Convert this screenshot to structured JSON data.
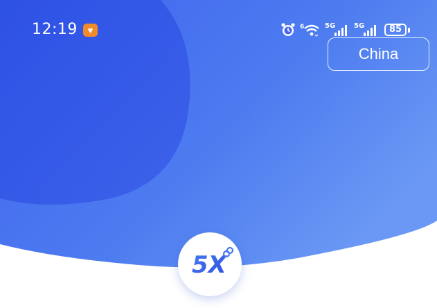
{
  "status_bar": {
    "time": "12:19",
    "notification_icon": "heart-icon",
    "network_1": "5G",
    "network_2": "5G",
    "wifi_badge": "6",
    "battery": "85"
  },
  "header": {
    "region_button_label": "China"
  },
  "logo": {
    "name": "app-logo-icon",
    "text": "5X"
  },
  "colors": {
    "hero_blue_light": "#4a76f0",
    "hero_blue_dark": "#2f55e6",
    "accent": "#2f5fe8",
    "notification_orange": "#f08a2a"
  }
}
